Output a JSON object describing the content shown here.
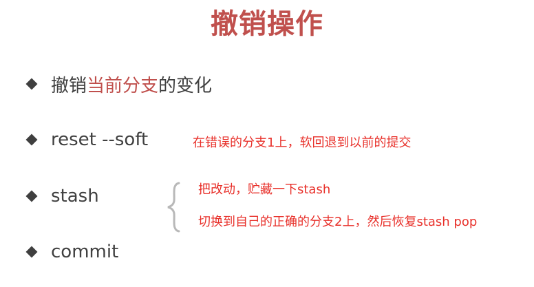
{
  "title": "撤销操作",
  "bullets": [
    {
      "before": "撤销",
      "highlight": "当前分支",
      "after": "的变化"
    },
    {
      "text": "reset --soft"
    },
    {
      "text": "stash"
    },
    {
      "text": "commit"
    }
  ],
  "notes": {
    "reset": "在错误的分支1上，软回退到以前的提交",
    "stash_1": "把改动，贮藏一下stash",
    "stash_2": "切换到自己的正确的分支2上，然后恢复stash pop"
  },
  "colors": {
    "title": "#c0504d",
    "highlight": "#c0504d",
    "note": "#e8302a",
    "bullet": "#3f3f3f",
    "text": "#404040",
    "brace": "#b8b8b8"
  }
}
